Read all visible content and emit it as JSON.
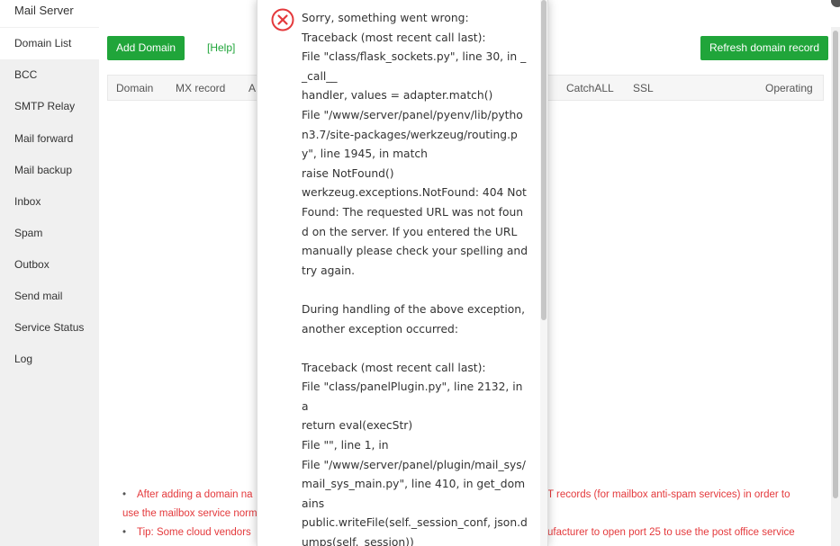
{
  "window": {
    "title": "Mail Server"
  },
  "sidebar": {
    "items": [
      {
        "label": "Domain List",
        "active": true
      },
      {
        "label": "BCC"
      },
      {
        "label": "SMTP Relay"
      },
      {
        "label": "Mail forward"
      },
      {
        "label": "Mail backup"
      },
      {
        "label": "Inbox"
      },
      {
        "label": "Spam"
      },
      {
        "label": "Outbox"
      },
      {
        "label": "Send mail"
      },
      {
        "label": "Service Status"
      },
      {
        "label": "Log"
      }
    ]
  },
  "toolbar": {
    "add_domain_label": "Add Domain",
    "help_label": "[Help]",
    "refresh_label": "Refresh domain record"
  },
  "table": {
    "columns": [
      "Domain",
      "MX record",
      "A",
      "CatchALL",
      "SSL",
      "Operating"
    ]
  },
  "tips": [
    {
      "text": "After adding a domain na",
      "right": "T records (for mailbox anti-spam services) in order to"
    },
    {
      "text": "use the mailbox service norm",
      "continuation": true
    },
    {
      "text": "Tip: Some cloud vendors",
      "right": "ufacturer to open port 25 to use the post office service"
    }
  ],
  "error_dialog": {
    "message": "Sorry, something went wrong:\nTraceback (most recent call last):\nFile \"class/flask_sockets.py\", line 30, in __call__\nhandler, values = adapter.match()\nFile \"/www/server/panel/pyenv/lib/python3.7/site-packages/werkzeug/routing.py\", line 1945, in match\nraise NotFound()\nwerkzeug.exceptions.NotFound: 404 Not Found: The requested URL was not found on the server. If you entered the URL manually please check your spelling and try again.\n\nDuring handling of the above exception, another exception occurred:\n\nTraceback (most recent call last):\nFile \"class/panelPlugin.py\", line 2132, in a\nreturn eval(execStr)\nFile \"\", line 1, in\nFile \"/www/server/panel/plugin/mail_sys/mail_sys_main.py\", line 410, in get_domains\npublic.writeFile(self._session_conf, json.dumps(self._session))"
  },
  "colors": {
    "accent": "#20a53a",
    "error": "#e4393c",
    "sidebar_bg": "#f0f0f0"
  }
}
